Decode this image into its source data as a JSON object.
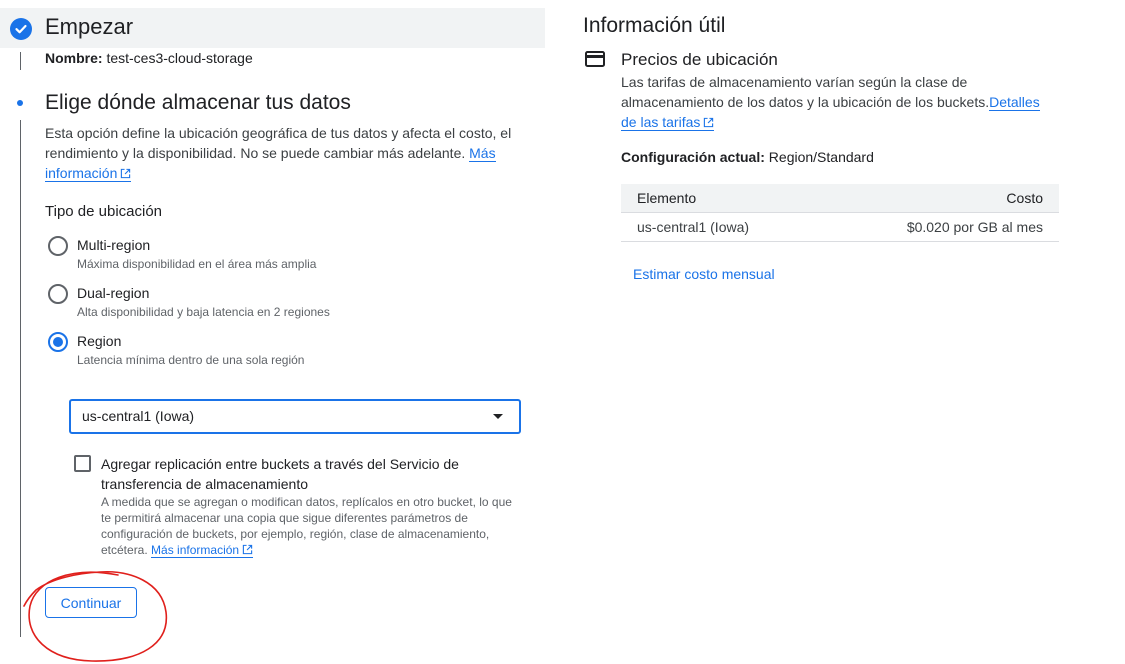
{
  "step1": {
    "title": "Empezar",
    "name_label": "Nombre:",
    "name_value": "test-ces3-cloud-storage"
  },
  "step2": {
    "title": "Elige dónde almacenar tus datos",
    "description": "Esta opción define la ubicación geográfica de tus datos y afecta el costo, el rendimiento y la disponibilidad. No se puede cambiar más adelante.",
    "more_info_link": "Más información",
    "location_type_label": "Tipo de ubicación",
    "options": [
      {
        "label": "Multi-region",
        "sub": "Máxima disponibilidad en el área más amplia",
        "selected": false
      },
      {
        "label": "Dual-region",
        "sub": "Alta disponibilidad y baja latencia en 2 regiones",
        "selected": false
      },
      {
        "label": "Region",
        "sub": "Latencia mínima dentro de una sola región",
        "selected": true
      }
    ],
    "region_select": {
      "value": "us-central1 (Iowa)"
    },
    "replication": {
      "label": "Agregar replicación entre buckets a través del Servicio de transferencia de almacenamiento",
      "description": "A medida que se agregan o modifican datos, replícalos en otro bucket, lo que te permitirá almacenar una copia que sigue diferentes parámetros de configuración de buckets, por ejemplo, región, clase de almacenamiento, etcétera.",
      "more_info_link": "Más información",
      "checked": false
    },
    "continue_button": "Continuar"
  },
  "info_panel": {
    "title": "Información útil",
    "pricing_title": "Precios de ubicación",
    "pricing_desc": "Las tarifas de almacenamiento varían según la clase de almacenamiento de los datos y la ubicación de los buckets.",
    "pricing_link": "Detalles de las tarifas",
    "config_label": "Configuración actual:",
    "config_value": "Region/Standard",
    "table": {
      "headers": [
        "Elemento",
        "Costo"
      ],
      "rows": [
        {
          "item": "us-central1 (Iowa)",
          "cost": "$0.020 por GB al mes"
        }
      ]
    },
    "estimate_link": "Estimar costo mensual"
  },
  "colors": {
    "accent": "#1a73e8",
    "annotation": "#e0201c"
  },
  "icons": [
    "check-circle-icon",
    "external-link-icon",
    "dropdown-arrow-icon",
    "credit-card-icon"
  ]
}
